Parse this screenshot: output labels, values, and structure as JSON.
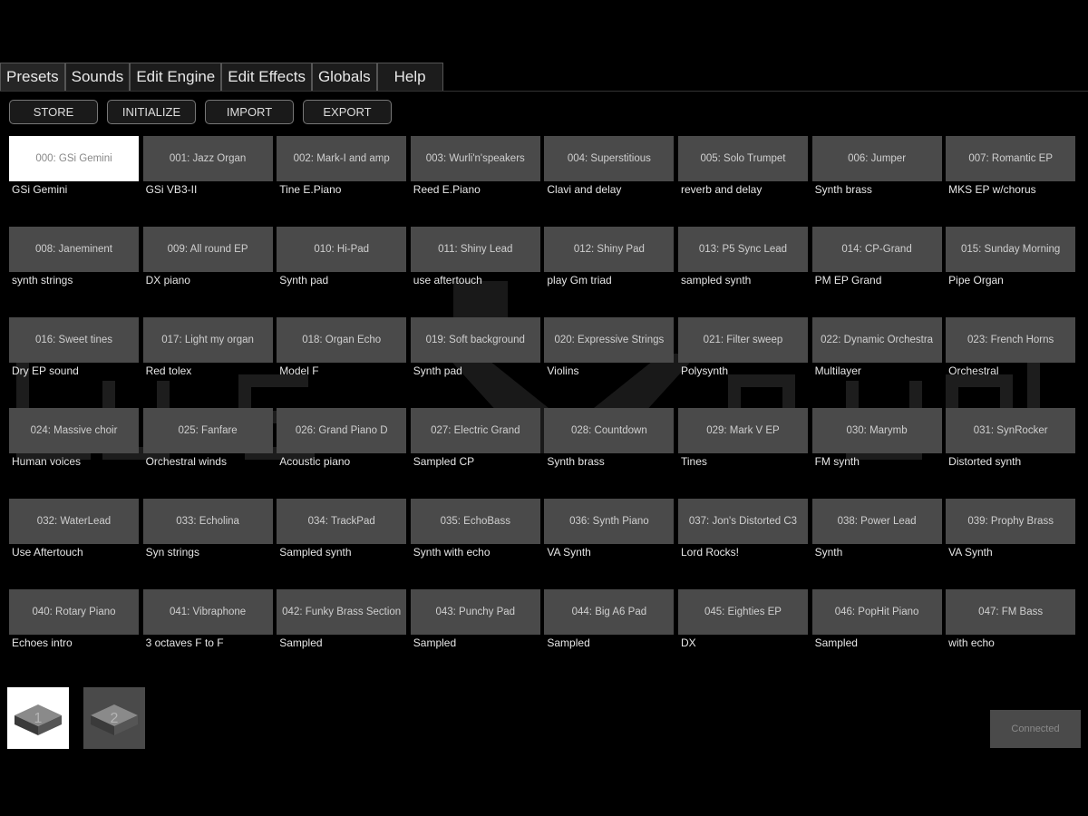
{
  "tabs": [
    "Presets",
    "Sounds",
    "Edit Engine",
    "Edit Effects",
    "Globals",
    "Help"
  ],
  "toolbar": {
    "store": "STORE",
    "initialize": "INITIALIZE",
    "import": "IMPORT",
    "export": "EXPORT"
  },
  "presets": [
    {
      "label": "000: GSi Gemini",
      "desc": "GSi Gemini",
      "selected": true
    },
    {
      "label": "001: Jazz Organ",
      "desc": "GSi VB3-II"
    },
    {
      "label": "002: Mark-I and amp",
      "desc": "Tine E.Piano"
    },
    {
      "label": "003: Wurli'n'speakers",
      "desc": "Reed E.Piano"
    },
    {
      "label": "004: Superstitious",
      "desc": "Clavi and delay"
    },
    {
      "label": "005: Solo Trumpet",
      "desc": "reverb and delay"
    },
    {
      "label": "006: Jumper",
      "desc": "Synth brass"
    },
    {
      "label": "007: Romantic EP",
      "desc": "MKS EP w/chorus"
    },
    {
      "label": "008: Janeminent",
      "desc": "synth strings"
    },
    {
      "label": "009: All round EP",
      "desc": "DX piano"
    },
    {
      "label": "010: Hi-Pad",
      "desc": "Synth pad"
    },
    {
      "label": "011: Shiny Lead",
      "desc": "use aftertouch"
    },
    {
      "label": "012: Shiny Pad",
      "desc": "play Gm triad"
    },
    {
      "label": "013: P5 Sync Lead",
      "desc": "sampled synth"
    },
    {
      "label": "014: CP-Grand",
      "desc": "PM EP Grand"
    },
    {
      "label": "015: Sunday Morning",
      "desc": "Pipe Organ"
    },
    {
      "label": "016: Sweet tines",
      "desc": "Dry EP sound"
    },
    {
      "label": "017: Light my organ",
      "desc": "Red tolex"
    },
    {
      "label": "018: Organ Echo",
      "desc": "Model F"
    },
    {
      "label": "019: Soft background",
      "desc": "Synth pad"
    },
    {
      "label": "020: Expressive Strings",
      "desc": "Violins"
    },
    {
      "label": "021: Filter sweep",
      "desc": "Polysynth"
    },
    {
      "label": "022: Dynamic Orchestra",
      "desc": "Multilayer"
    },
    {
      "label": "023: French Horns",
      "desc": "Orchestral"
    },
    {
      "label": "024: Massive choir",
      "desc": "Human voices"
    },
    {
      "label": "025: Fanfare",
      "desc": "Orchestral winds"
    },
    {
      "label": "026: Grand Piano D",
      "desc": "Acoustic piano"
    },
    {
      "label": "027: Electric Grand",
      "desc": "Sampled CP"
    },
    {
      "label": "028: Countdown",
      "desc": "Synth brass"
    },
    {
      "label": "029: Mark V EP",
      "desc": "Tines"
    },
    {
      "label": "030: Marymb",
      "desc": "FM synth"
    },
    {
      "label": "031: SynRocker",
      "desc": "Distorted synth"
    },
    {
      "label": "032: WaterLead",
      "desc": "Use Aftertouch"
    },
    {
      "label": "033: Echolina",
      "desc": "Syn strings"
    },
    {
      "label": "034: TrackPad",
      "desc": "Sampled synth"
    },
    {
      "label": "035: EchoBass",
      "desc": "Synth with echo"
    },
    {
      "label": "036: Synth Piano",
      "desc": "VA Synth"
    },
    {
      "label": "037: Jon's Distorted C3",
      "desc": "Lord Rocks!"
    },
    {
      "label": "038: Power Lead",
      "desc": "Synth"
    },
    {
      "label": "039: Prophy Brass",
      "desc": "VA Synth"
    },
    {
      "label": "040: Rotary Piano",
      "desc": "Echoes intro"
    },
    {
      "label": "041: Vibraphone",
      "desc": "3 octaves F to F"
    },
    {
      "label": "042: Funky Brass Section",
      "desc": "Sampled"
    },
    {
      "label": "043: Punchy Pad",
      "desc": "Sampled"
    },
    {
      "label": "044: Big A6 Pad",
      "desc": "Sampled"
    },
    {
      "label": "045: Eighties EP",
      "desc": "DX"
    },
    {
      "label": "046: PopHit Piano",
      "desc": "Sampled"
    },
    {
      "label": "047: FM Bass",
      "desc": "with echo"
    }
  ],
  "banks": [
    {
      "label": "1",
      "active": true
    },
    {
      "label": "2",
      "active": false
    }
  ],
  "status": "Connected",
  "colors": {
    "background": "#000000",
    "button": "#4a4a4a",
    "selected": "#ffffff"
  }
}
